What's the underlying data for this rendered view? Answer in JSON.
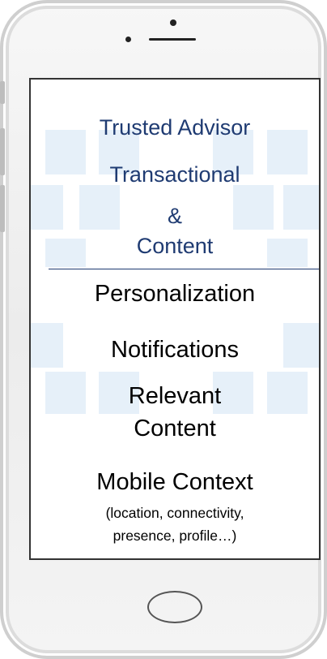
{
  "header": {
    "trusted_advisor": "Trusted Advisor",
    "transactional": "Transactional",
    "ampersand": "&",
    "content": "Content"
  },
  "features": {
    "personalization": "Personalization",
    "notifications": "Notifications",
    "relevant_line1": "Relevant",
    "relevant_line2": "Content",
    "mobile_context": "Mobile Context",
    "context_detail_line1": "(location, connectivity,",
    "context_detail_line2": "presence,  profile…)"
  },
  "colors": {
    "header_text": "#1f3b72",
    "body_text": "#000000",
    "tile": "#e6f0f9"
  }
}
